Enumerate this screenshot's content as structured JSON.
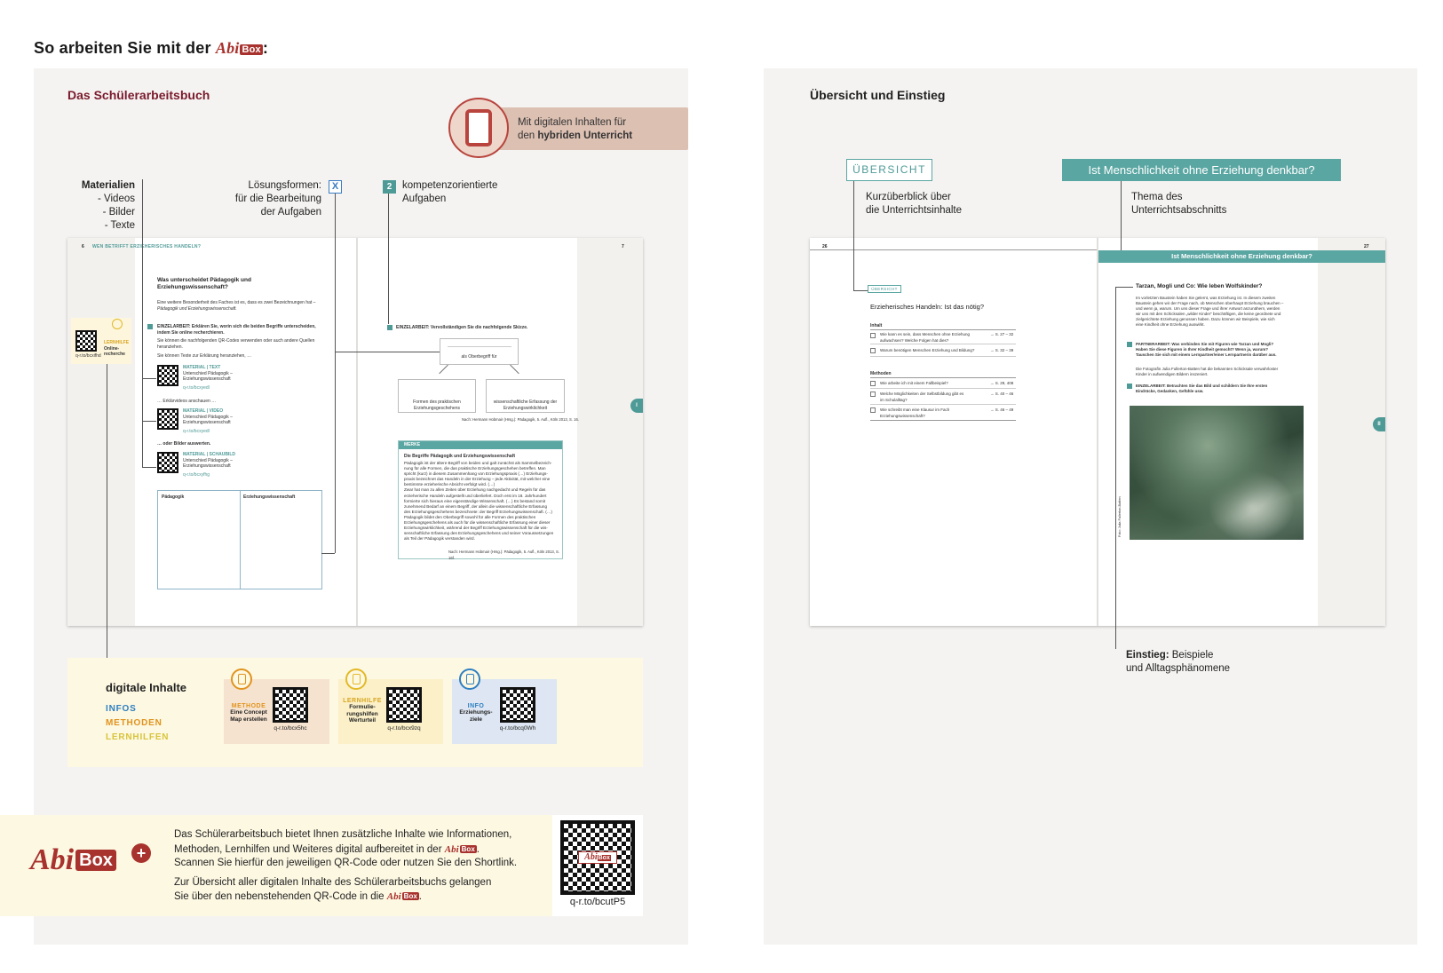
{
  "header": {
    "title_prefix": "So arbeiten Sie mit der",
    "logo_abi": "Abi",
    "logo_box": "Box",
    "title_suffix": ":"
  },
  "left": {
    "section_title": "Das Schülerarbeitsbuch",
    "digital_badge": {
      "line1": "Mit digitalen Inhalten für",
      "line2_prefix": "den ",
      "line2_bold": "hybriden Unterricht"
    },
    "materials": {
      "title": "Materialien",
      "items": [
        "- Videos",
        "- Bilder",
        "- Texte"
      ]
    },
    "loesung": {
      "line1": "Lösungsformen:",
      "line2": "für die Bearbeitung",
      "line3": "der Aufgaben",
      "mark": "X"
    },
    "kompetenz": {
      "num": "2",
      "line1": "kompetenzorientierte",
      "line2": "Aufgaben"
    },
    "book": {
      "page_left_num": "6",
      "page_right_num": "7",
      "running_head": "WEN BETRIFFT ERZIEHERISCHES HANDELN?",
      "question_l1": "Was unterscheidet Pädagogik und",
      "question_l2": "Erziehungswissenschaft?",
      "intro_l1": "Eine weitere Besonderheit des Faches ist es, dass es zwei Bezeichnungen hat –",
      "intro_l2": "Pädagogik und Erziehungswissenschaft.",
      "task1_l1": "EINZELARBEIT: Erklären Sie, worin sich die beiden Begriffe unterscheiden,",
      "task1_l2": "indem Sie online recherchieren.",
      "task1_note_l1": "Sie können die nachfolgenden QR-Codes verwenden oder auch andere Quellen",
      "task1_note_l2": "heranziehen.",
      "texts_intro": "Sie können Texte zur Erklärung heranziehen, …",
      "m1_tag": "MATERIAL | TEXT",
      "m1_l1": "Unterschied Pädagogik –",
      "m1_l2": "Erziehungswissenschaft",
      "m1_code": "q-r.to/bcxyedl",
      "videos_intro": "… Erklärvideos anschauen …",
      "m2_tag": "MATERIAL | VIDEO",
      "m2_l1": "Unterschied Pädagogik –",
      "m2_l2": "Erziehungswissenschaft",
      "m2_code": "q-r.to/bcxyedl",
      "pics_intro": "… oder Bilder auswerten.",
      "m3_tag": "MATERIAL | SCHAUBILD",
      "m3_l1": "Unterschied Pädagogik –",
      "m3_l2": "Erziehungswissenschaft",
      "m3_code": "q-r.to/bcxyfhg",
      "side_tag": "LERNHILFE",
      "side_l1": "Online-",
      "side_l2": "recherche",
      "side_code": "q-r.to/bcxifhd",
      "table_col1": "Pädagogik",
      "table_col2": "Erziehungswissenschaft",
      "task2_l1": "EINZELARBEIT: Vervollständigen Sie die nachfolgende Skizze.",
      "mm_top": "als Oberbegriff für",
      "mm_left_l1": "Formen des praktischen",
      "mm_left_l2": "Erziehungsgeschehens",
      "mm_right_l1": "wissenschaftliche Erfassung der",
      "mm_right_l2": "Erziehungswirklichkeit",
      "mm_source": "Nach: Hermann Hobmair (Hrsg.): Pädagogik, 5. Aufl., Köln 2013, S. 16.",
      "merke_hdr": "MERKE",
      "merke_title": "Die Begriffe Pädagogik und Erziehungswissenschaft",
      "merke_body": [
        "Pädagogik ist der ältere Begriff von beiden und galt zunächst als Sammelbezeich-",
        "nung für alle Formen, die das praktische Erziehungsgeschehen betreffen. Man",
        "spricht (kurz) in diesem Zusammenhang von Erziehungspraxis (…) Erziehungs-",
        "praxis bezeichnet das Handeln in der Erziehung – jede Aktivität, mit welcher eine",
        "bestimmte erzieherische Absicht verfolgt wird. (…)",
        "Zwar hat man zu allen Zeiten über Erziehung nachgedacht und Regeln für das",
        "erzieherische Handeln aufgestellt und überliefert. Doch erst im 18. Jahrhundert",
        "formierte sich hieraus eine eigenständige Wissenschaft. (…) Es bestand somit",
        "zunehmend Bedarf an einem Begriff, der allein die wissenschaftliche Erfassung",
        "des Erziehungsgeschehens bezeichnete: der Begriff Erziehungswissenschaft. (…)",
        "Pädagogik bildet den Oberbegriff sowohl für alle Formen des praktischen",
        "Erziehungsgeschehens als auch für die wissenschaftliche Erfassung einer dieser",
        "Erziehungswirklichkeit, während der Begriff Erziehungswissenschaft für die wis-",
        "senschaftliche Erfassung des Erziehungsgeschehens und seiner Voraussetzungen",
        "als Teil der Pädagogik verstanden wird."
      ],
      "merke_source": "Nach: Hermann Hobmair (Hrsg.): Pädagogik, 5. Aufl., Köln 2013, S. 16f.",
      "side_marker": "I"
    },
    "digital": {
      "title": "digitale Inhalte",
      "infos": "INFOS",
      "methoden": "METHODEN",
      "lernhilfen": "LERNHILFEN",
      "cards": [
        {
          "tag": "METHODE",
          "l1": "Eine Concept",
          "l2": "Map erstellen",
          "l3": "",
          "code": "q-r.to/bcx5hc"
        },
        {
          "tag": "LERNHILFE",
          "l1": "Formulie-",
          "l2": "rungshilfen",
          "l3": "Werturteil",
          "code": "q-r.to/bcx9zq"
        },
        {
          "tag": "INFO",
          "l1": "Erziehungs-",
          "l2": "ziele",
          "l3": "",
          "code": "q-r.to/bcq0Wh"
        }
      ]
    },
    "promo": {
      "p1_l1": "Das Schülerarbeitsbuch bietet Ihnen zusätzliche Inhalte wie Informationen,",
      "p1_l2": "Methoden, Lernhilfen und Weiteres digital aufbereitet in der",
      "p1_l3": "Scannen Sie hierfür den jeweiligen QR-Code oder nutzen Sie den Shortlink.",
      "p2_l1": "Zur Übersicht aller digitalen Inhalte des Schülerarbeitsbuchs gelangen",
      "p2_l2": "Sie über den nebenstehenden QR-Code in die",
      "logo_abi": "Abi",
      "logo_box": "Box",
      "plus": "+",
      "shortlink": "q-r.to/bcutP5"
    }
  },
  "right": {
    "section_title": "Übersicht und Einstieg",
    "ueb_tag": "ÜBERSICHT",
    "ueb_l1": "Kurzüberblick über",
    "ueb_l2": "die Unterrichtsinhalte",
    "theme_tag": "Ist Menschlichkeit ohne Erziehung denkbar?",
    "theme_l1": "Thema des",
    "theme_l2": "Unterrichtsabschnitts",
    "einstieg_bold": "Einstieg:",
    "einstieg_l1": " Beispiele",
    "einstieg_l2": "und Alltagsphänomene",
    "book": {
      "page_left_num": "26",
      "page_right_num": "27",
      "ueb_small": "ÜBERSICHT",
      "ueb_question": "Erzieherisches Handeln: Ist das nötig?",
      "group1": "Inhalt",
      "rows1": [
        {
          "l1": "Wie kann es sein, dass Menschen ohne Erziehung",
          "l2": "aufwachsen? Welche Folgen hat dies?",
          "ref": "→ S. 27 – 32"
        },
        {
          "l1": "Warum benötigen Menschen Erziehung und Bildung?",
          "l2": "",
          "ref": "→ S. 32 – 39"
        }
      ],
      "group2": "Methoden",
      "rows2": [
        {
          "l1": "Wie arbeite ich mit einem Fallbeispiel?",
          "l2": "",
          "ref": "→ S. 29, 408"
        },
        {
          "l1": "Welche Möglichkeiten der Selbstbildung gibt es",
          "l2": "im Schulalltag?",
          "ref": "→ S. 40 – 46"
        },
        {
          "l1": "Wie schreibt man eine Klausur im Fach",
          "l2": "Erziehungswissenschaft?",
          "ref": "→ S. 46 – 49"
        }
      ],
      "bar_title": "Ist Menschlichkeit ohne Erziehung denkbar?",
      "tarzan": "Tarzan, Mogli und Co: Wie leben Wolfskinder?",
      "tarzan_body": [
        "Im vorletzten Baustein haben Sie gelernt, was Erziehung ist. In diesem zweiten",
        "Baustein gehen wir der Frage nach, ob Menschen überhaupt Erziehung brauchen –",
        "und wenn ja, warum. Um uns dieser Frage und ihrer Antwort anzunähern, werden",
        "wir uns mit den Schicksalen „wilder Kinder“ beschäftigen, die keine geordnete und",
        "zielgerichtete Erziehung genossen haben. Dazu können wir Beispiele, wie sich",
        "eine Kindheit ohne Erziehung auswirkt."
      ],
      "t1_l1": "PARTNERARBEIT: Was verbinden Sie mit Figuren wie Tarzan und Mogli?",
      "t1_l2": "Haben Sie diese Figuren in Ihrer Kindheit gemocht? Wenn ja, warum?",
      "t1_l3": "Tauschen Sie sich mit einem Lernpartner/einer Lernpartnerin darüber aus.",
      "photo_note_l1": "Die Fotografin Julia Fullerton-Batten hat die bekannten Schicksale verwahrloster",
      "photo_note_l2": "Kinder in aufwendigen Bildern inszeniert.",
      "t2_l1": "EINZELARBEIT: Betrachten Sie das Bild und schildern Sie Ihre ersten",
      "t2_l2": "Eindrücke, Gedanken, Gefühle usw.",
      "side_marker": "II",
      "credit": "Foto: Julia Fullerton-Batten"
    }
  },
  "colors": {
    "accent_red": "#a8322d",
    "teal": "#5aa6a2",
    "info_blue": "#2f7fc1",
    "methode_orange": "#e0931e",
    "lernhilfe_yellow": "#d8c43c"
  }
}
